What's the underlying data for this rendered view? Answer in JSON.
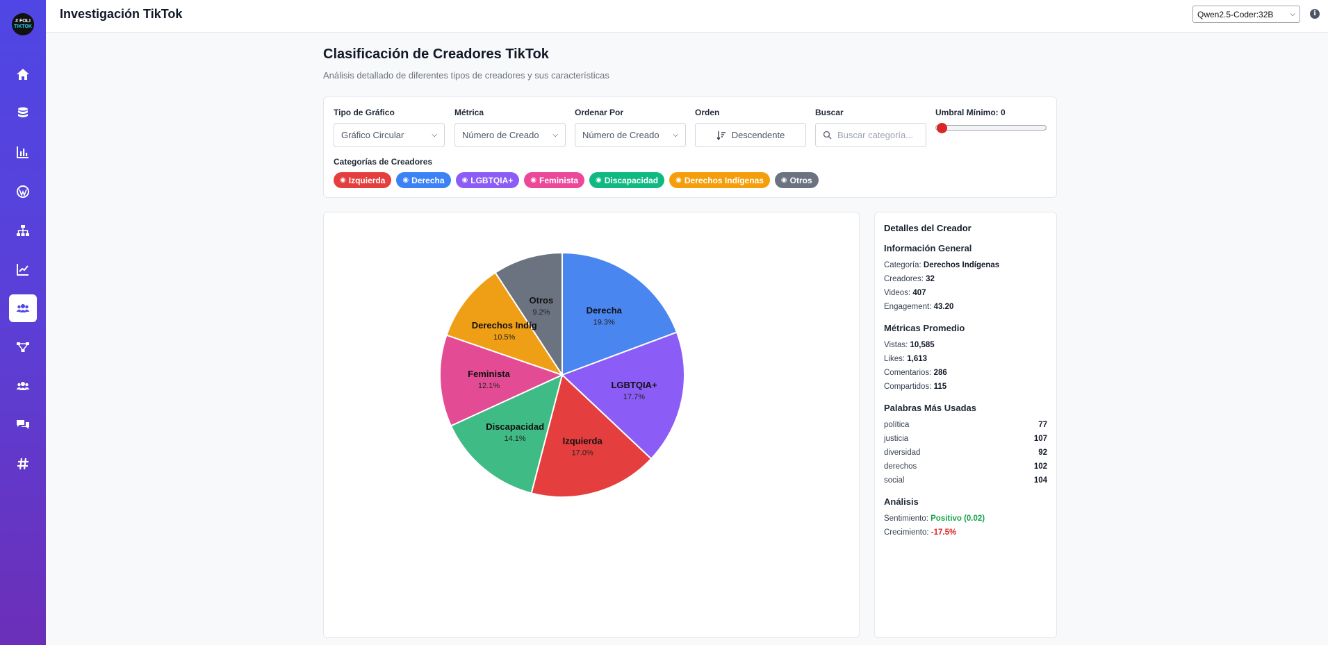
{
  "header": {
    "title": "Investigación TikTok",
    "model_selected": "Qwen2.5-Coder:32B",
    "logo_top": "# FOLI",
    "logo_bottom": "TIKTOK"
  },
  "sidebar": {
    "items": [
      {
        "icon": "home-icon"
      },
      {
        "icon": "database-icon"
      },
      {
        "icon": "bar-chart-icon"
      },
      {
        "icon": "wordpress-icon"
      },
      {
        "icon": "sitemap-icon"
      },
      {
        "icon": "line-chart-icon"
      },
      {
        "icon": "users-icon",
        "active": true
      },
      {
        "icon": "network-icon"
      },
      {
        "icon": "group-icon"
      },
      {
        "icon": "comments-icon"
      },
      {
        "icon": "hashtag-icon"
      }
    ]
  },
  "page": {
    "title": "Clasificación de Creadores TikTok",
    "subtitle": "Análisis detallado de diferentes tipos de creadores y sus características"
  },
  "filters": {
    "chart_type_label": "Tipo de Gráfico",
    "chart_type_value": "Gráfico Circular",
    "metric_label": "Métrica",
    "metric_value": "Número de Creado",
    "sort_by_label": "Ordenar Por",
    "sort_by_value": "Número de Creado",
    "order_label": "Orden",
    "order_value": "Descendente",
    "search_label": "Buscar",
    "search_placeholder": "Buscar categoría...",
    "threshold_label": "Umbral Mínimo: 0",
    "threshold_fraction": 0,
    "categories_label": "Categorías de Creadores",
    "chips": [
      {
        "label": "Izquierda",
        "color": "#e53e3e"
      },
      {
        "label": "Derecha",
        "color": "#3b82f6"
      },
      {
        "label": "LGBTQIA+",
        "color": "#8b5cf6"
      },
      {
        "label": "Feminista",
        "color": "#ec4899"
      },
      {
        "label": "Discapacidad",
        "color": "#10b981"
      },
      {
        "label": "Derechos Indígenas",
        "color": "#f59e0b"
      },
      {
        "label": "Otros",
        "color": "#6b7280"
      }
    ]
  },
  "chart_data": {
    "type": "pie",
    "categories": [
      "Derecha",
      "LGBTQIA+",
      "Izquierda",
      "Discapacidad",
      "Feminista",
      "Derechos Indíg",
      "Otros"
    ],
    "values": [
      19.3,
      17.7,
      17.0,
      14.1,
      12.1,
      10.5,
      9.2
    ],
    "labels": [
      "19.3%",
      "17.7%",
      "17.0%",
      "14.1%",
      "12.1%",
      "10.5%",
      "9.2%"
    ],
    "colors": [
      "#4a86f0",
      "#8b5cf6",
      "#e53e3e",
      "#3fbb85",
      "#e34b95",
      "#ef9f16",
      "#6b7280"
    ]
  },
  "details": {
    "title": "Detalles del Creador",
    "general": {
      "heading": "Información General",
      "category_label": "Categoría:",
      "category_value": "Derechos Indígenas",
      "creators_label": "Creadores:",
      "creators_value": "32",
      "videos_label": "Videos:",
      "videos_value": "407",
      "engagement_label": "Engagement:",
      "engagement_value": "43.20"
    },
    "metrics": {
      "heading": "Métricas Promedio",
      "views_label": "Vistas:",
      "views_value": "10,585",
      "likes_label": "Likes:",
      "likes_value": "1,613",
      "comments_label": "Comentarios:",
      "comments_value": "286",
      "shares_label": "Compartidos:",
      "shares_value": "115"
    },
    "words": {
      "heading": "Palabras Más Usadas",
      "items": [
        {
          "word": "política",
          "count": "77"
        },
        {
          "word": "justicia",
          "count": "107"
        },
        {
          "word": "diversidad",
          "count": "92"
        },
        {
          "word": "derechos",
          "count": "102"
        },
        {
          "word": "social",
          "count": "104"
        }
      ]
    },
    "analysis": {
      "heading": "Análisis",
      "sentiment_label": "Sentimiento:",
      "sentiment_value": "Positivo (0.02)",
      "growth_label": "Crecimiento:",
      "growth_value": "-17.5%"
    }
  }
}
